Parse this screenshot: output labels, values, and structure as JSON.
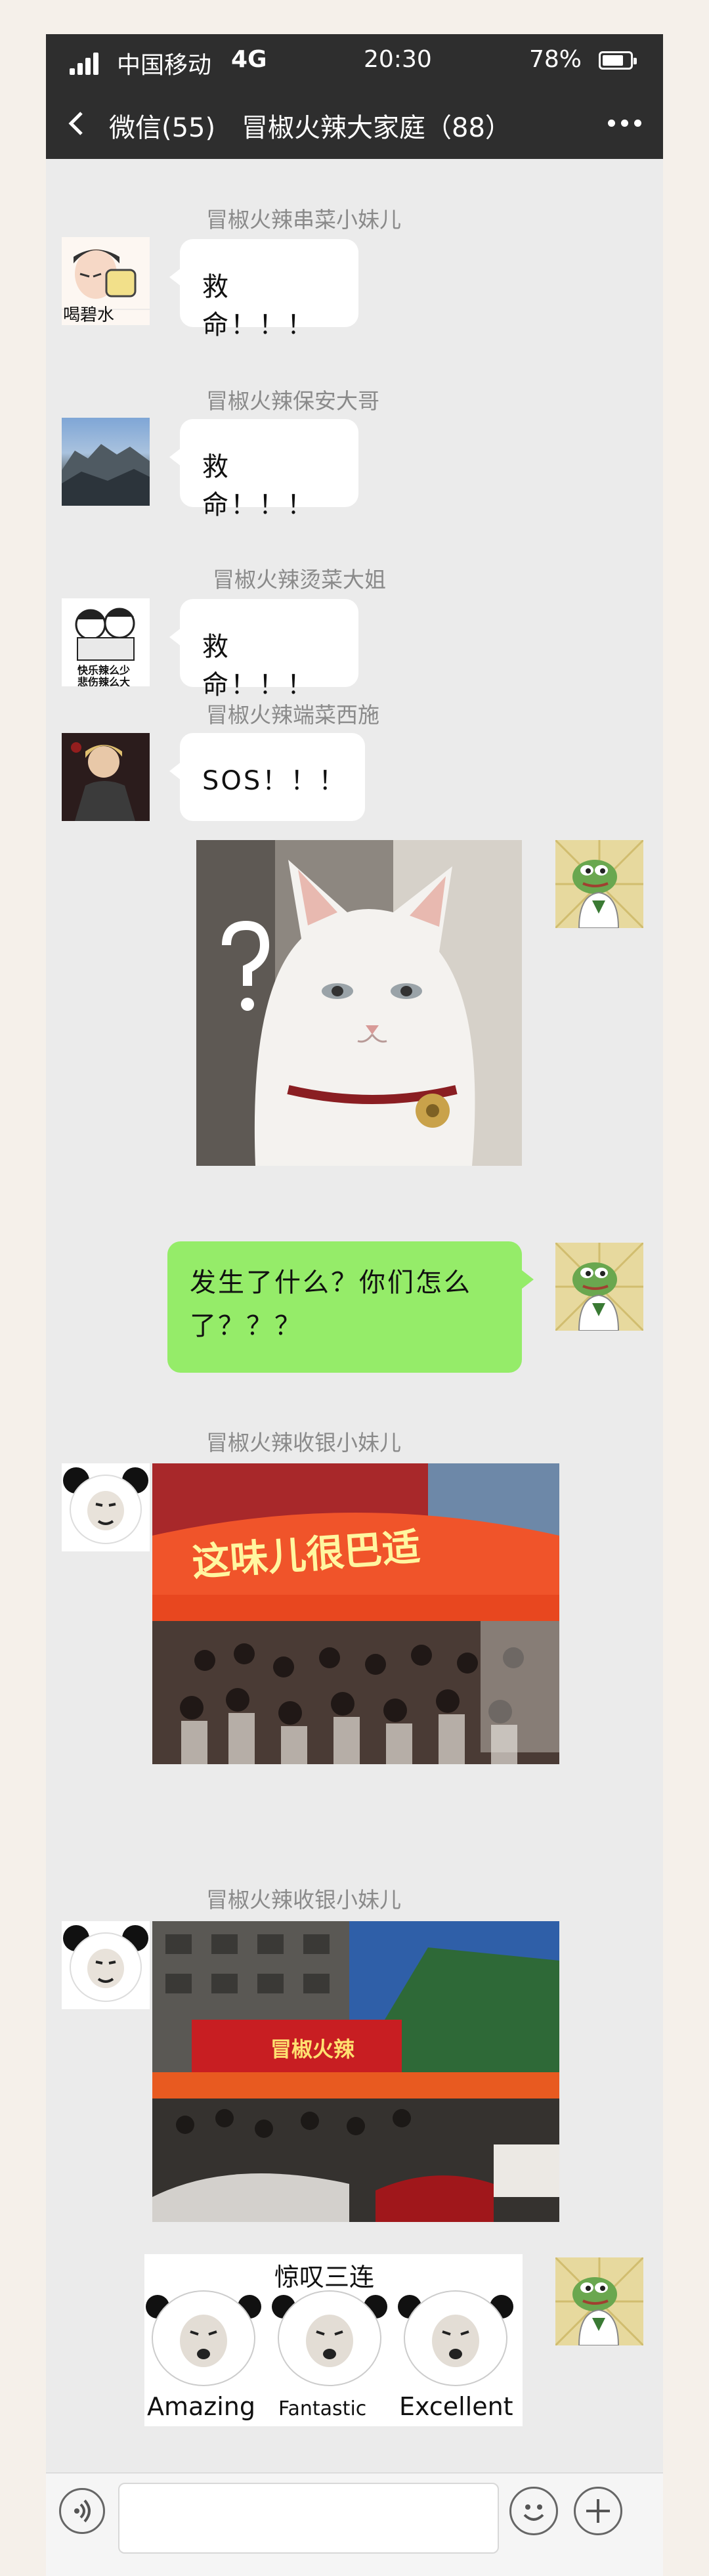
{
  "status_bar": {
    "carrier": "中国移动",
    "network": "4G",
    "time": "20:30",
    "battery": "78%",
    "battery_level": 0.78
  },
  "nav": {
    "back_label": "微信(55)",
    "title": "冒椒火辣大家庭（88）",
    "back_icon": "chevron-left-icon",
    "more_icon": "more-dots-icon"
  },
  "messages": [
    {
      "sender": "冒椒火辣串菜小妹儿",
      "text": "救命！！！",
      "avatar_caption": "喝碧水"
    },
    {
      "sender": "冒椒火辣保安大哥",
      "text": "救命！！！"
    },
    {
      "sender": "冒椒火辣烫菜大姐",
      "text": "救命！！！",
      "avatar_caption_1": "快乐辣么少",
      "avatar_caption_2": "悲伤辣么大"
    },
    {
      "sender": "冒椒火辣端菜西施",
      "text": "SOS！！！"
    },
    {
      "self": true,
      "type": "image",
      "image_label": "question-cat-photo"
    },
    {
      "self": true,
      "text_line1": "发生了什么？你们怎么",
      "text_line2": "了？？？"
    },
    {
      "sender": "冒椒火辣收银小妹儿",
      "type": "image",
      "shop_sign": "这味儿很巴适"
    },
    {
      "sender": "冒椒火辣收银小妹儿",
      "type": "image",
      "shop_sign": "冒椒火辣"
    },
    {
      "self": true,
      "type": "sticker",
      "sticker_title": "惊叹三连",
      "sticker_words": [
        "Amazing",
        "Fantastic",
        "Excellent"
      ]
    }
  ],
  "colors": {
    "header": "#2e2e2e",
    "chat_bg": "#ebebeb",
    "self_bubble": "#95ec69",
    "other_bubble": "#ffffff",
    "sender_name": "#8a8a8a"
  },
  "input_bar": {
    "voice_icon": "voice-icon",
    "emoji_icon": "emoji-icon",
    "plus_icon": "plus-icon"
  }
}
